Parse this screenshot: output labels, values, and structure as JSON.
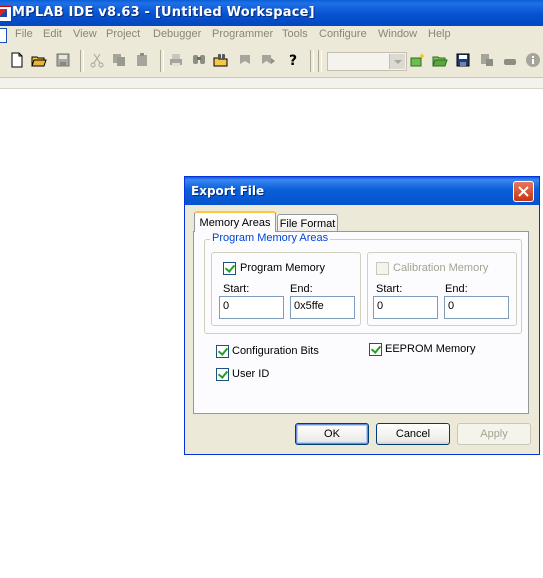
{
  "window": {
    "title": "MPLAB IDE v8.63 - [Untitled Workspace]"
  },
  "menu": {
    "items": [
      "File",
      "Edit",
      "View",
      "Project",
      "Debugger",
      "Programmer",
      "Tools",
      "Configure",
      "Window",
      "Help"
    ]
  },
  "toolbar": {
    "icons": [
      "new-file-icon",
      "open-folder-icon",
      "save-icon",
      "cut-icon",
      "copy-icon",
      "paste-icon",
      "print-icon",
      "find-icon",
      "find-in-files-icon",
      "bookmark-icon",
      "bookmark-next-icon",
      "help-icon",
      "new-project-icon",
      "open-project-icon",
      "save-project-icon",
      "build-icon",
      "make-icon",
      "info-icon"
    ],
    "config_combo_value": ""
  },
  "dialog": {
    "title": "Export File",
    "tabs": [
      "Memory Areas",
      "File Format"
    ],
    "active_tab": "Memory Areas",
    "program_memory_group": {
      "legend": "Program Memory Areas",
      "program_memory": {
        "label": "Program Memory",
        "checked": true,
        "start_label": "Start:",
        "end_label": "End:",
        "start_value": "0",
        "end_value": "0x5ffe"
      },
      "calibration_memory": {
        "label": "Calibration Memory",
        "checked": false,
        "enabled": false,
        "start_label": "Start:",
        "end_label": "End:",
        "start_value": "0",
        "end_value": "0"
      }
    },
    "configuration_bits": {
      "label": "Configuration Bits",
      "checked": true
    },
    "eeprom_memory": {
      "label": "EEPROM Memory",
      "checked": true
    },
    "user_id": {
      "label": "User ID",
      "checked": true
    },
    "buttons": {
      "ok": "OK",
      "cancel": "Cancel",
      "apply": "Apply"
    }
  }
}
